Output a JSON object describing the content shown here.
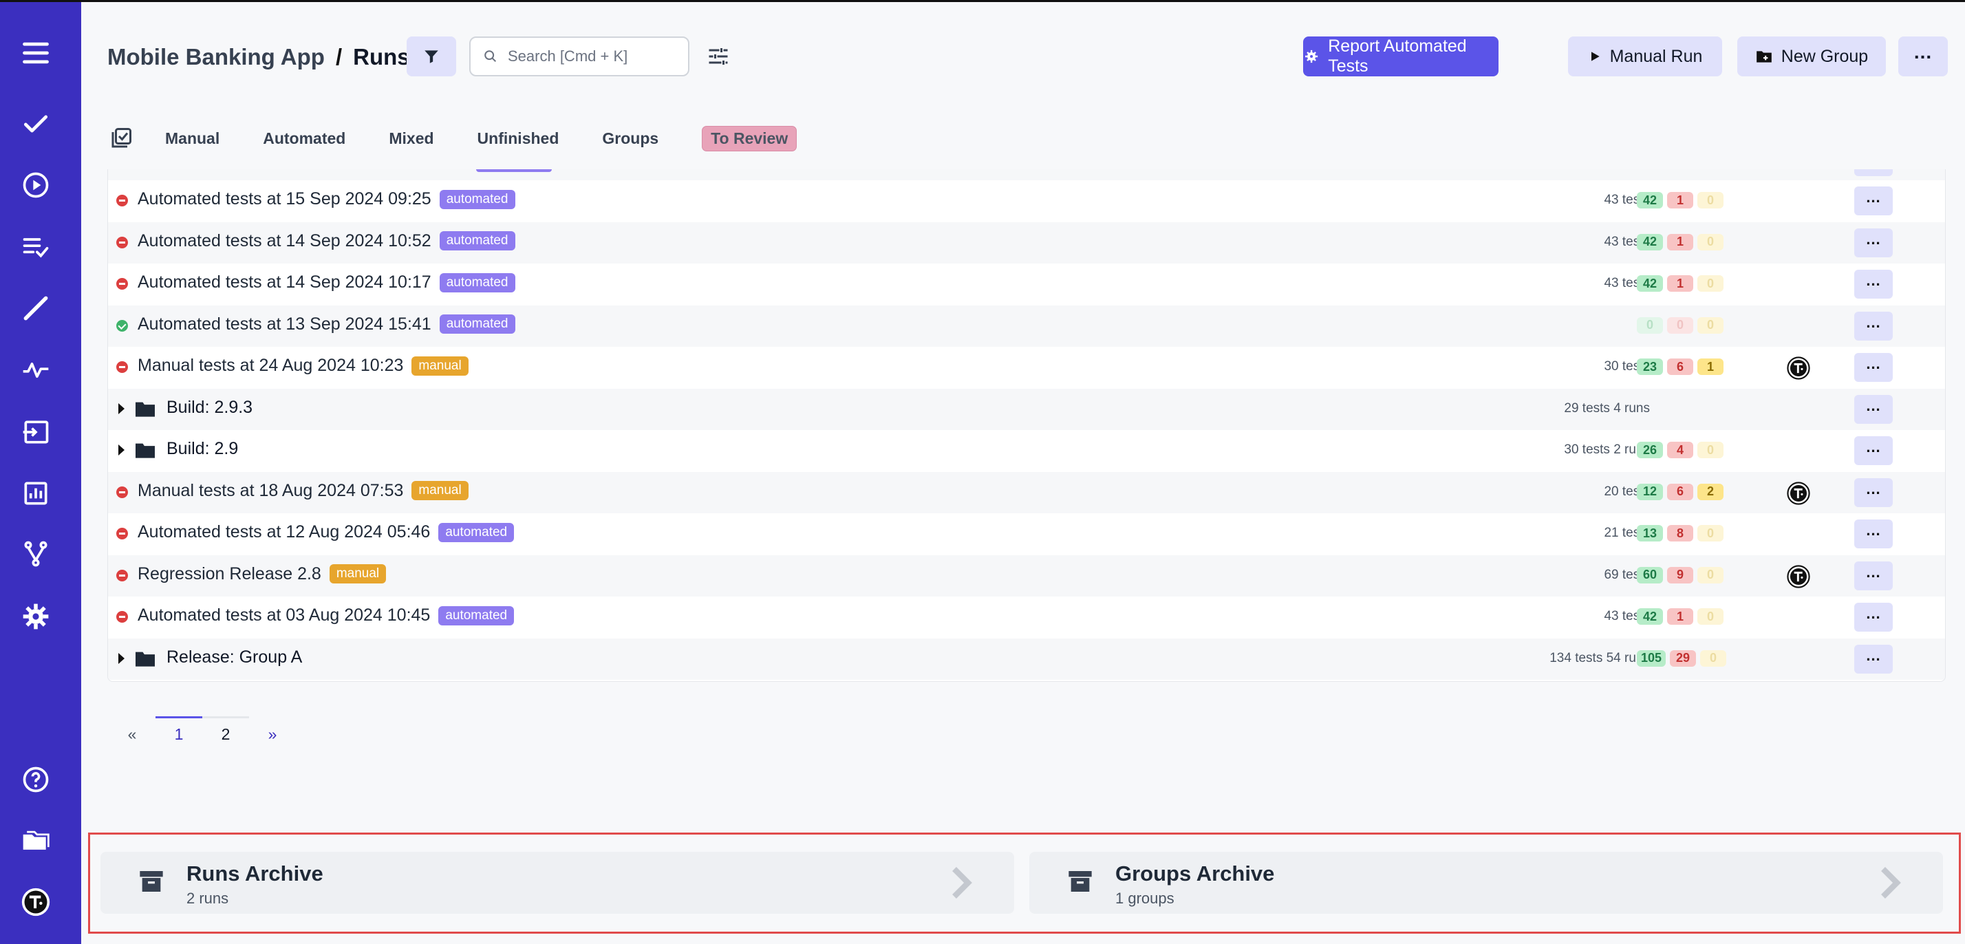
{
  "app": {
    "project": "Mobile Banking App",
    "separator": "/",
    "page": "Runs"
  },
  "search": {
    "placeholder": "Search [Cmd + K]"
  },
  "actions": {
    "report": "Report Automated Tests",
    "manual_run": "Manual Run",
    "new_group": "New Group",
    "more": "..."
  },
  "tabs": [
    "Manual",
    "Automated",
    "Mixed",
    "Unfinished",
    "Groups",
    "To Review"
  ],
  "rows": [
    {
      "kind": "run",
      "status": "fail",
      "title": "Automated tests at 15 Sep 2024 09:25",
      "tag": "automated",
      "count": "43 tests",
      "passed": "42",
      "failed": "1",
      "skipped": "0",
      "faded": [
        false,
        false,
        true
      ],
      "avatar": false
    },
    {
      "kind": "run",
      "status": "fail",
      "title": "Automated tests at 14 Sep 2024 10:52",
      "tag": "automated",
      "count": "43 tests",
      "passed": "42",
      "failed": "1",
      "skipped": "0",
      "faded": [
        false,
        false,
        true
      ],
      "avatar": false
    },
    {
      "kind": "run",
      "status": "fail",
      "title": "Automated tests at 14 Sep 2024 10:17",
      "tag": "automated",
      "count": "43 tests",
      "passed": "42",
      "failed": "1",
      "skipped": "0",
      "faded": [
        false,
        false,
        true
      ],
      "avatar": false
    },
    {
      "kind": "run",
      "status": "ok",
      "title": "Automated tests at 13 Sep 2024 15:41",
      "tag": "automated",
      "count": "",
      "passed": "0",
      "failed": "0",
      "skipped": "0",
      "faded": [
        true,
        true,
        true
      ],
      "avatar": false
    },
    {
      "kind": "run",
      "status": "fail",
      "title": "Manual tests at 24 Aug 2024 10:23",
      "tag": "manual",
      "count": "30 tests",
      "passed": "23",
      "failed": "6",
      "skipped": "1",
      "faded": [
        false,
        false,
        false
      ],
      "avatar": true
    },
    {
      "kind": "group",
      "title": "Build: 2.9.3",
      "count": "29 tests 4 runs"
    },
    {
      "kind": "group",
      "title": "Build: 2.9",
      "count": "30 tests 2 runs",
      "passed": "26",
      "failed": "4",
      "skipped": "0",
      "faded": [
        false,
        false,
        true
      ]
    },
    {
      "kind": "run",
      "status": "fail",
      "title": "Manual tests at 18 Aug 2024 07:53",
      "tag": "manual",
      "count": "20 tests",
      "passed": "12",
      "failed": "6",
      "skipped": "2",
      "faded": [
        false,
        false,
        false
      ],
      "avatar": true
    },
    {
      "kind": "run",
      "status": "fail",
      "title": "Automated tests at 12 Aug 2024 05:46",
      "tag": "automated",
      "count": "21 tests",
      "passed": "13",
      "failed": "8",
      "skipped": "0",
      "faded": [
        false,
        false,
        true
      ],
      "avatar": false
    },
    {
      "kind": "run",
      "status": "fail",
      "title": "Regression Release 2.8",
      "tag": "manual",
      "count": "69 tests",
      "passed": "60",
      "failed": "9",
      "skipped": "0",
      "faded": [
        false,
        false,
        true
      ],
      "avatar": true
    },
    {
      "kind": "run",
      "status": "fail",
      "title": "Automated tests at 03 Aug 2024 10:45",
      "tag": "automated",
      "count": "43 tests",
      "passed": "42",
      "failed": "1",
      "skipped": "0",
      "faded": [
        false,
        false,
        true
      ],
      "avatar": false
    },
    {
      "kind": "group",
      "title": "Release: Group A",
      "count": "134 tests 54 runs",
      "passed": "105",
      "failed": "29",
      "skipped": "0",
      "faded": [
        false,
        false,
        true
      ]
    }
  ],
  "pagination": {
    "prev": "«",
    "pages": [
      "1",
      "2"
    ],
    "current": "1",
    "next": "»"
  },
  "archive": {
    "runs": {
      "title": "Runs Archive",
      "subtitle": "2 runs"
    },
    "groups": {
      "title": "Groups Archive",
      "subtitle": "1 groups"
    }
  },
  "colors": {
    "sidebar": "#3b2fbf",
    "primary": "#5b54e8",
    "soft": "#e0e1fb",
    "highlight": "#e14b4b"
  }
}
